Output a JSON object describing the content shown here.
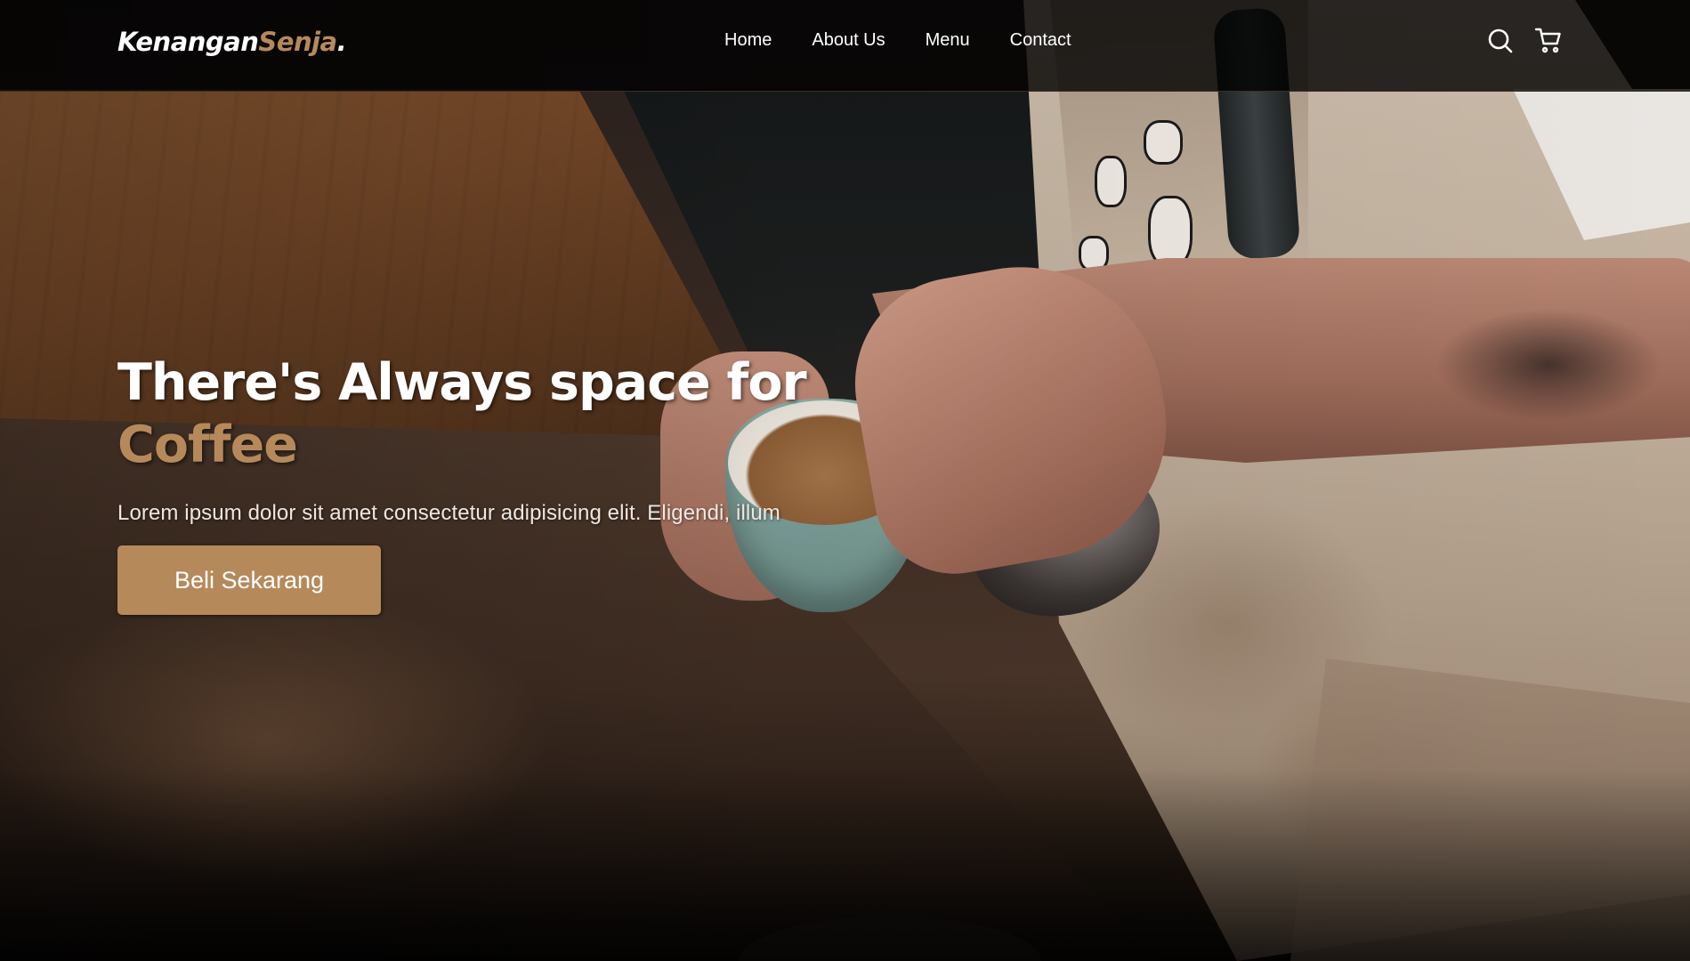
{
  "brand": {
    "name_main": "Kenangan",
    "name_accent": "Senja",
    "name_suffix": "."
  },
  "nav": {
    "links": [
      {
        "label": "Home"
      },
      {
        "label": "About Us"
      },
      {
        "label": "Menu"
      },
      {
        "label": "Contact"
      }
    ],
    "icons": [
      "search-icon",
      "shopping-cart-icon"
    ]
  },
  "hero": {
    "headline_main": "There's Always space for",
    "headline_accent": "Coffee",
    "description": "Lorem ipsum dolor sit amet consectetur adipisicing elit. Eligendi, illum",
    "cta_label": "Beli Sekarang"
  },
  "colors": {
    "accent": "#b6895b",
    "navbar_bg": "rgba(0,0,0,0.8)",
    "text": "#ffffff"
  }
}
